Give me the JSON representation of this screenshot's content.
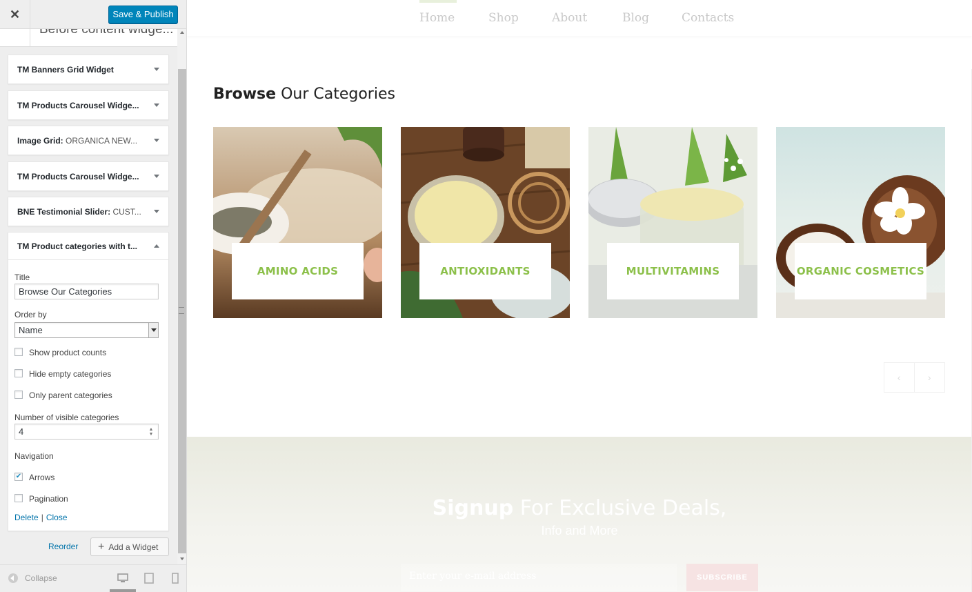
{
  "customizer": {
    "save_label": "Save & Publish",
    "close_icon": "close-icon",
    "section_title": "Before content widge...",
    "widgets": [
      {
        "title": "TM Banners Grid Widget",
        "sub": ""
      },
      {
        "title": "TM Products Carousel Widge...",
        "sub": ""
      },
      {
        "title": "Image Grid:",
        "sub": " ORGANICA NEW..."
      },
      {
        "title": "TM Products Carousel Widge...",
        "sub": ""
      },
      {
        "title": "BNE Testimonial Slider:",
        "sub": " CUST..."
      }
    ],
    "open_widget": {
      "title": "TM Product categories with t...",
      "fields": {
        "title_label": "Title",
        "title_value": "Browse Our Categories",
        "order_label": "Order by",
        "order_value": "Name",
        "show_counts": "Show product counts",
        "hide_empty": "Hide empty categories",
        "only_parent": "Only parent categories",
        "visible_label": "Number of visible categories",
        "visible_value": "4",
        "nav_label": "Navigation",
        "arrows": "Arrows",
        "pagination": "Pagination"
      },
      "checked": {
        "show_counts": false,
        "hide_empty": false,
        "only_parent": false,
        "arrows": true,
        "pagination": false
      },
      "delete": "Delete",
      "sep": "|",
      "close": "Close"
    },
    "reorder": "Reorder",
    "add_widget": "Add a Widget",
    "collapse": "Collapse",
    "devices": [
      "desktop-icon",
      "tablet-icon",
      "mobile-icon"
    ]
  },
  "preview": {
    "nav": [
      "Home",
      "Shop",
      "About",
      "Blog",
      "Contacts"
    ],
    "heading_bold": "Browse",
    "heading_rest": " Our Categories",
    "categories": [
      "AMINO ACIDS",
      "ANTIOXIDANTS",
      "MULTIVITAMINS",
      "ORGANIC COSMETICS"
    ],
    "prev_arrow": "‹",
    "next_arrow": "›",
    "signup_bold": "Signup",
    "signup_rest": " For Exclusive Deals,",
    "signup_sub": "Info and More",
    "email_placeholder": "Enter your e-mail address",
    "subscribe": "SUBSCRIBE"
  },
  "colors": {
    "accent": "#0085ba",
    "category_green": "#8cc04a",
    "link": "#0073aa"
  }
}
